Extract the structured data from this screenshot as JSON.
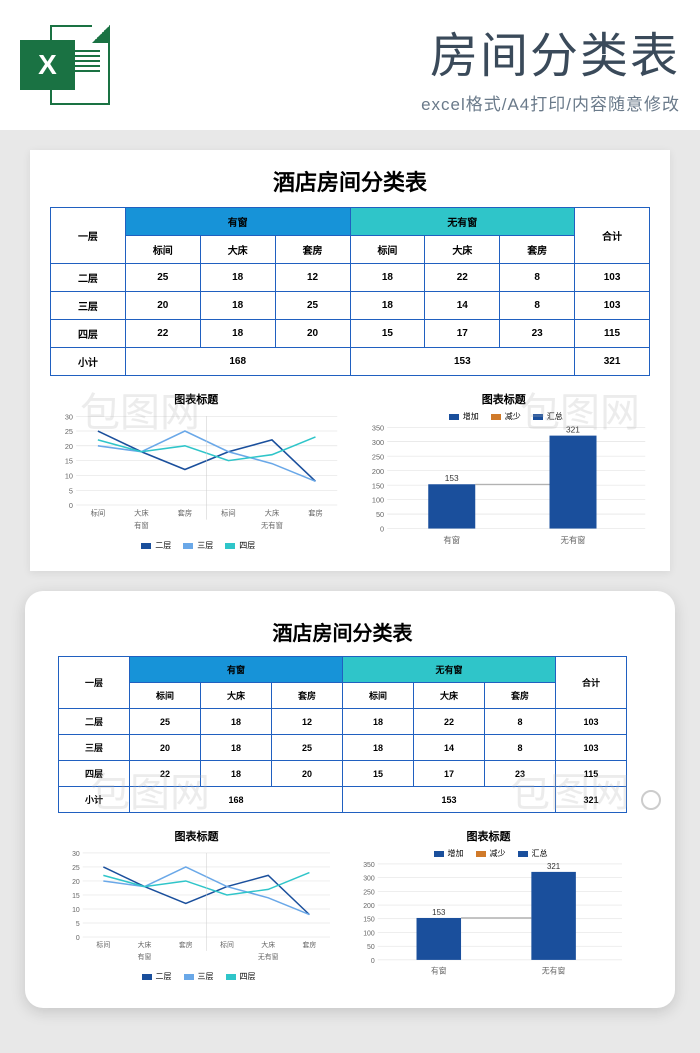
{
  "header": {
    "icon_letter": "X",
    "title": "房间分类表",
    "subtitle": "excel格式/A4打印/内容随意修改"
  },
  "sheet": {
    "title": "酒店房间分类表",
    "group1": "有窗",
    "group2": "无有窗",
    "total_col": "合计",
    "row_headers": [
      "一层",
      "二层",
      "三层",
      "四层",
      "小计"
    ],
    "col_headers": [
      "标间",
      "大床",
      "套房",
      "标间",
      "大床",
      "套房"
    ],
    "rows": [
      {
        "label": "二层",
        "cells": [
          "25",
          "18",
          "12",
          "18",
          "22",
          "8"
        ],
        "total": "103"
      },
      {
        "label": "三层",
        "cells": [
          "20",
          "18",
          "25",
          "18",
          "14",
          "8"
        ],
        "total": "103"
      },
      {
        "label": "四层",
        "cells": [
          "22",
          "18",
          "20",
          "15",
          "17",
          "23"
        ],
        "total": "115"
      }
    ],
    "subtotal": {
      "label": "小计",
      "g1": "168",
      "g2": "153",
      "total": "321"
    }
  },
  "chart_data": [
    {
      "type": "line",
      "title": "图表标题",
      "categories": [
        "标间",
        "大床",
        "套房",
        "标间",
        "大床",
        "套房"
      ],
      "group_labels": [
        "有窗",
        "无有窗"
      ],
      "series": [
        {
          "name": "二层",
          "color": "#1a4f9c",
          "values": [
            25,
            18,
            12,
            18,
            22,
            8
          ]
        },
        {
          "name": "三层",
          "color": "#6aa8e8",
          "values": [
            20,
            18,
            25,
            18,
            14,
            8
          ]
        },
        {
          "name": "四层",
          "color": "#2fc5c9",
          "values": [
            22,
            18,
            20,
            15,
            17,
            23
          ]
        }
      ],
      "ylim": [
        0,
        30
      ],
      "yticks": [
        0,
        5,
        10,
        15,
        20,
        25,
        30
      ]
    },
    {
      "type": "bar",
      "title": "图表标题",
      "categories": [
        "有窗",
        "无有窗"
      ],
      "series": [
        {
          "name": "增加",
          "color": "#1a4f9c"
        },
        {
          "name": "减少",
          "color": "#d07a2a"
        },
        {
          "name": "汇总",
          "color": "#1a4f9c"
        }
      ],
      "values": [
        153,
        321
      ],
      "value_labels": [
        "153",
        "321"
      ],
      "ylim": [
        0,
        350
      ],
      "yticks": [
        0,
        50,
        100,
        150,
        200,
        250,
        300,
        350
      ],
      "connector": true
    }
  ]
}
